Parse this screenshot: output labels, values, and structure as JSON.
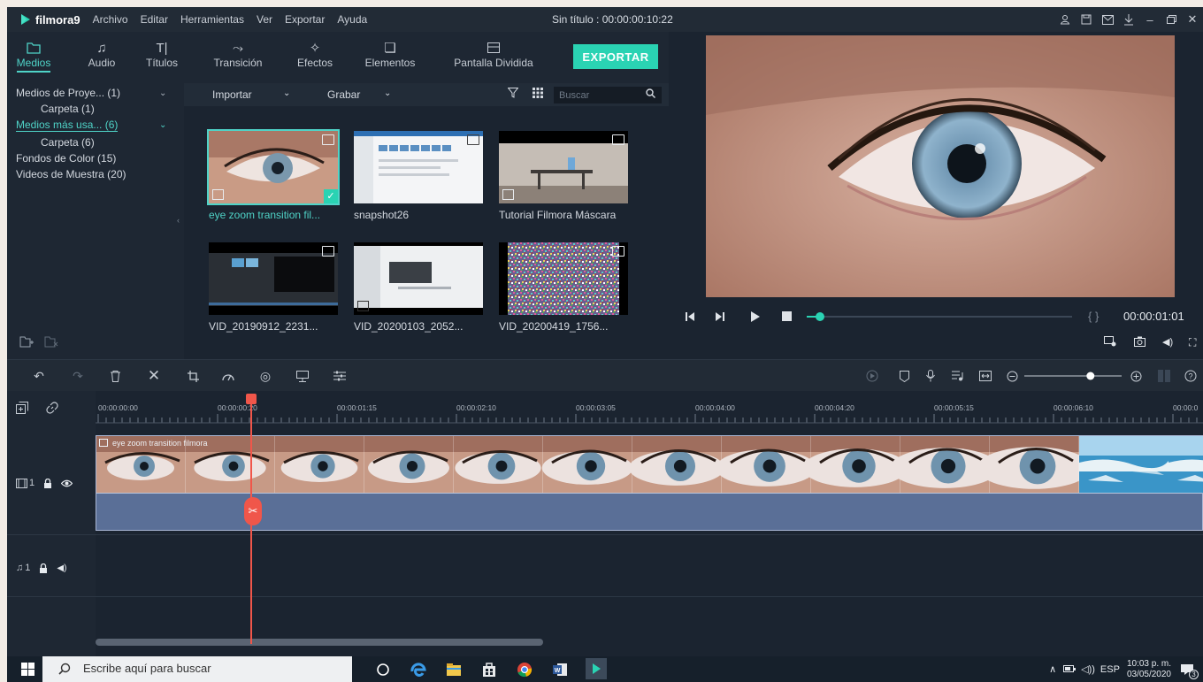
{
  "app": {
    "logo_text": "filmora9",
    "menu": [
      "Archivo",
      "Editar",
      "Herramientas",
      "Ver",
      "Exportar",
      "Ayuda"
    ],
    "doc_title": "Sin título : 00:00:00:10:22"
  },
  "media_tabs": [
    {
      "label": "Medios",
      "icon": "folder-icon",
      "active": true
    },
    {
      "label": "Audio",
      "icon": "music-note-icon",
      "active": false
    },
    {
      "label": "Títulos",
      "icon": "text-icon",
      "active": false
    },
    {
      "label": "Transición",
      "icon": "transition-icon",
      "active": false
    },
    {
      "label": "Efectos",
      "icon": "effects-icon",
      "active": false
    },
    {
      "label": "Elementos",
      "icon": "elements-icon",
      "active": false
    },
    {
      "label": "Pantalla Dividida",
      "icon": "split-screen-icon",
      "active": false
    }
  ],
  "export_label": "EXPORTAR",
  "library": {
    "items": [
      {
        "label": "Medios de Proye... (1)",
        "sub": false,
        "highlight": false,
        "arrow": true
      },
      {
        "label": "Carpeta (1)",
        "sub": true,
        "highlight": false,
        "arrow": false
      },
      {
        "label": "Medios más usa... (6)",
        "sub": false,
        "highlight": true,
        "arrow": true
      },
      {
        "label": "Carpeta (6)",
        "sub": true,
        "highlight": false,
        "arrow": false
      },
      {
        "label": "Fondos de Color (15)",
        "sub": false,
        "highlight": false,
        "arrow": false
      },
      {
        "label": "Videos de Muestra (20)",
        "sub": false,
        "highlight": false,
        "arrow": false
      }
    ]
  },
  "media_toolbar": {
    "import_label": "Importar",
    "record_label": "Grabar",
    "search_placeholder": "Buscar"
  },
  "media_items": [
    {
      "name": "eye zoom transition fil...",
      "selected": true
    },
    {
      "name": "snapshot26",
      "selected": false
    },
    {
      "name": "Tutorial Filmora Máscara",
      "selected": false
    },
    {
      "name": "VID_20190912_2231...",
      "selected": false
    },
    {
      "name": "VID_20200103_2052...",
      "selected": false
    },
    {
      "name": "VID_20200419_1756...",
      "selected": false
    }
  ],
  "preview": {
    "time": "00:00:01:01",
    "progress": 0.05
  },
  "ruler": {
    "labels": [
      "00:00:00:00",
      "00:00:00:20",
      "00:00:01:15",
      "00:00:02:10",
      "00:00:03:05",
      "00:00:04:00",
      "00:00:04:20",
      "00:00:05:15",
      "00:00:06:10",
      "00:00:0"
    ]
  },
  "timeline": {
    "video_track_label": "1",
    "audio_track_label": "1",
    "clip_name": "eye zoom transition filmora",
    "zoom_level": 0.68
  },
  "taskbar": {
    "search_placeholder": "Escribe aquí para buscar",
    "language": "ESP",
    "time": "10:03 p. m.",
    "date": "03/05/2020",
    "notification_count": "3"
  }
}
